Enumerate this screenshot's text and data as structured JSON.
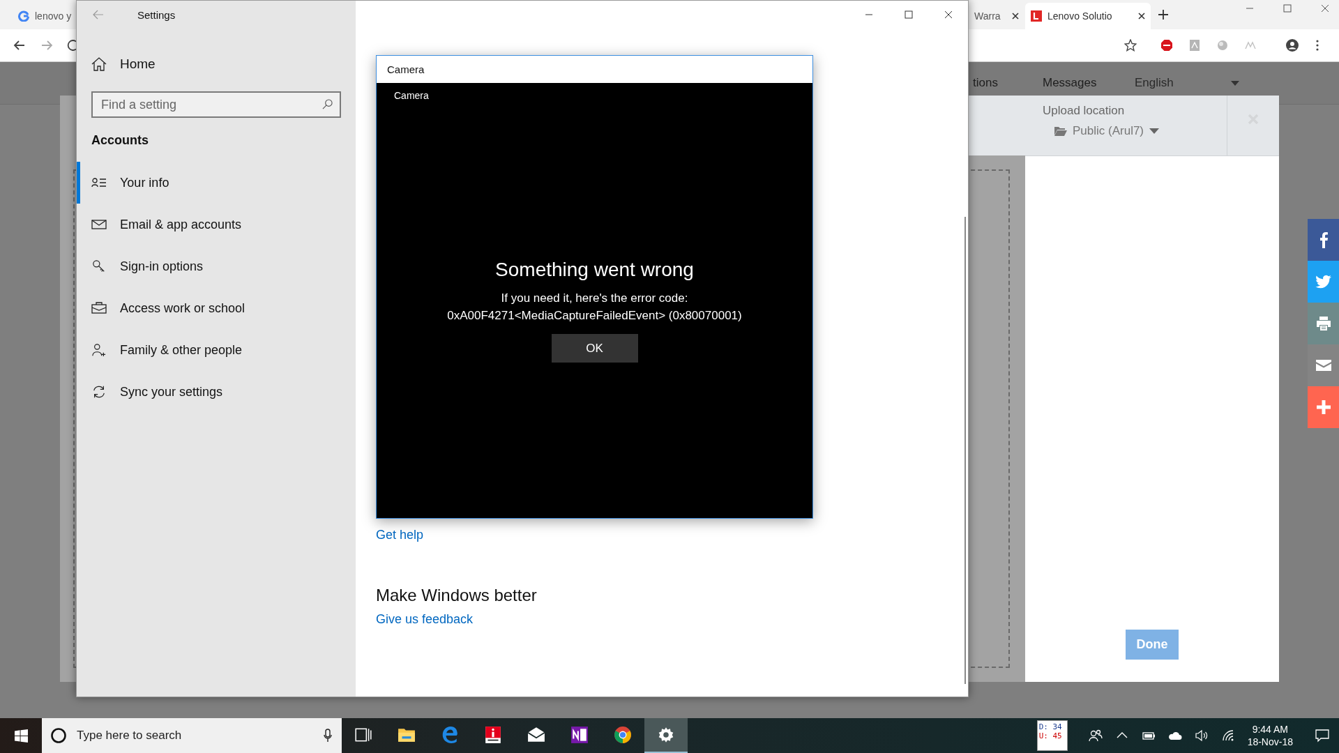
{
  "browser": {
    "tabs": [
      {
        "label": "lenovo y",
        "kind": "google",
        "selected": false
      },
      {
        "label": "Warra",
        "kind": "plain",
        "selected": false
      },
      {
        "label": "Lenovo Solutio",
        "kind": "lenovo",
        "selected": true
      }
    ],
    "nav": [
      {
        "label": "tions"
      },
      {
        "label": "Messages"
      }
    ],
    "language": "English",
    "upload": {
      "label": "Upload location",
      "location": "Public (Arul7)",
      "button": "Done"
    },
    "share": [
      {
        "kind": "facebook",
        "color": "#3b5998"
      },
      {
        "kind": "twitter",
        "color": "#1da1f2"
      },
      {
        "kind": "print",
        "color": "#6e8a8a"
      },
      {
        "kind": "email",
        "color": "#848484"
      },
      {
        "kind": "more",
        "color": "#ff6550"
      }
    ]
  },
  "settings": {
    "title": "Settings",
    "home": "Home",
    "search": {
      "placeholder": "Find a setting"
    },
    "section": "Accounts",
    "items": [
      {
        "label": "Your info",
        "kind": "info",
        "selected": true
      },
      {
        "label": "Email & app accounts",
        "kind": "email",
        "selected": false
      },
      {
        "label": "Sign-in options",
        "kind": "key",
        "selected": false
      },
      {
        "label": "Access work or school",
        "kind": "briefcase",
        "selected": false
      },
      {
        "label": "Family & other people",
        "kind": "family",
        "selected": false
      },
      {
        "label": "Sync your settings",
        "kind": "sync",
        "selected": false
      }
    ],
    "help_link": "Get help",
    "feedback_heading": "Make Windows better",
    "feedback_link": "Give us feedback"
  },
  "camera_dialog": {
    "title": "Camera",
    "app_title": "Camera",
    "heading": "Something went wrong",
    "message": "If you need it, here's the error code:",
    "code": "0xA00F4271<MediaCaptureFailedEvent> (0x80070001)",
    "button": "OK"
  },
  "taskbar": {
    "search_placeholder": "Type here to search",
    "apps": [
      {
        "kind": "task-view",
        "selected": false
      },
      {
        "kind": "explorer",
        "selected": false
      },
      {
        "kind": "edge",
        "selected": false
      },
      {
        "kind": "iball",
        "selected": false
      },
      {
        "kind": "mail",
        "selected": false
      },
      {
        "kind": "onenote",
        "selected": false
      },
      {
        "kind": "chrome",
        "selected": false
      },
      {
        "kind": "settings",
        "selected": true
      }
    ],
    "meter": {
      "download": "D: 34",
      "upload": "U: 45"
    },
    "time": "9:44 AM",
    "date": "18-Nov-18"
  }
}
